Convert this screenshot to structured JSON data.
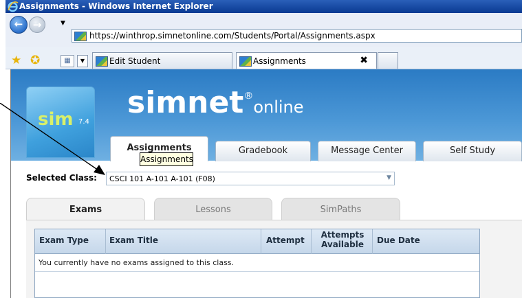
{
  "window": {
    "title": "Assignments - Windows Internet Explorer",
    "url": "https://winthrop.simnetonline.com/Students/Portal/Assignments.aspx"
  },
  "browser_tabs": [
    {
      "label": "Edit Student",
      "active": false
    },
    {
      "label": "Assignments",
      "active": true
    }
  ],
  "brand": {
    "name": "simnet",
    "reg": "®",
    "suffix": "online",
    "logo_text": "sim",
    "version": "7.4"
  },
  "nav_tabs": [
    {
      "label": "Assignments",
      "active": true
    },
    {
      "label": "Gradebook"
    },
    {
      "label": "Message Center"
    },
    {
      "label": "Self Study"
    }
  ],
  "tooltip": "Assignments",
  "class_select": {
    "label": "Selected Class:",
    "value": "CSCI 101 A-101 A-101 (F08)"
  },
  "content_tabs": [
    {
      "label": "Exams",
      "active": true
    },
    {
      "label": "Lessons"
    },
    {
      "label": "SimPaths"
    }
  ],
  "table": {
    "columns": [
      "Exam Type",
      "Exam Title",
      "Attempt",
      "Attempts Available",
      "Due Date"
    ],
    "empty_message": "You currently have no exams assigned to this class."
  },
  "colors": {
    "header_blue": "#2b7bc4",
    "tooltip_bg": "#ffffe1"
  }
}
